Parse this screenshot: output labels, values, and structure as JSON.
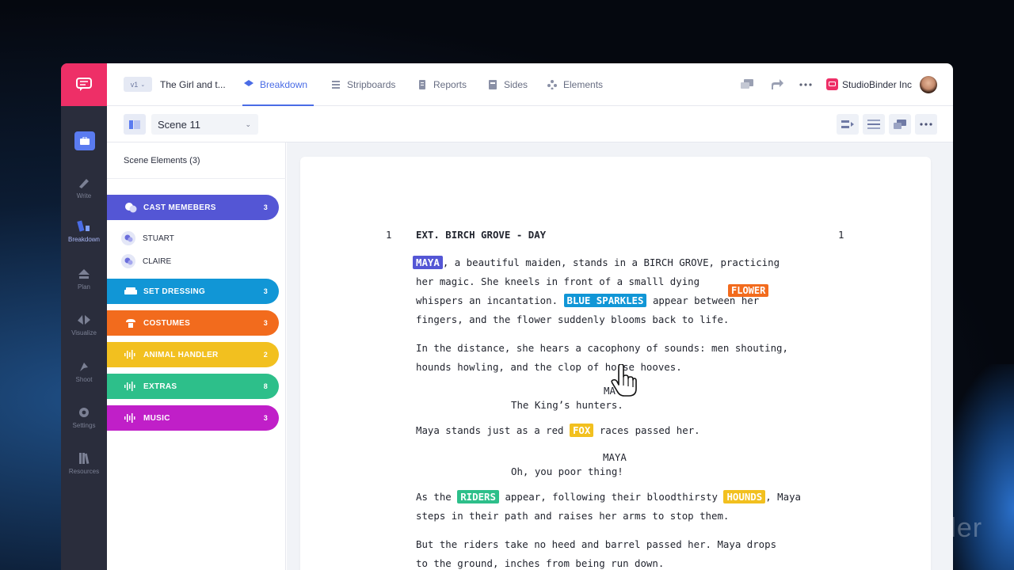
{
  "app": {
    "version": "v1",
    "project_title": "The Girl and t...",
    "company": "StudioBinder Inc",
    "background_brand": "nder"
  },
  "rail": {
    "items": [
      {
        "label": "Write",
        "icon": "pencil-icon"
      },
      {
        "label": "Breakdown",
        "icon": "breakdown-icon"
      },
      {
        "label": "Plan",
        "icon": "plan-icon"
      },
      {
        "label": "Visualize",
        "icon": "visualize-icon"
      },
      {
        "label": "Shoot",
        "icon": "shoot-icon"
      },
      {
        "label": "Settings",
        "icon": "gear-icon"
      },
      {
        "label": "Resources",
        "icon": "books-icon"
      }
    ]
  },
  "tabs": [
    {
      "label": "Breakdown",
      "icon": "layers-icon",
      "active": true
    },
    {
      "label": "Stripboards",
      "icon": "list-icon",
      "active": false
    },
    {
      "label": "Reports",
      "icon": "report-icon",
      "active": false
    },
    {
      "label": "Sides",
      "icon": "sides-icon",
      "active": false
    },
    {
      "label": "Elements",
      "icon": "elements-icon",
      "active": false
    }
  ],
  "subbar": {
    "scene": "Scene 11"
  },
  "panel": {
    "title": "Scene Elements (3)",
    "categories": [
      {
        "label": "CAST MEMEBERS",
        "count": "3",
        "color": "#5456d5",
        "icon": "masks-icon"
      },
      {
        "label": "SET DRESSING",
        "count": "3",
        "color": "#1196d6",
        "icon": "sofa-icon"
      },
      {
        "label": "COSTUMES",
        "count": "3",
        "color": "#f26b1d",
        "icon": "costume-icon"
      },
      {
        "label": "ANIMAL HANDLER",
        "count": "2",
        "color": "#f2c01f",
        "icon": "audio-icon"
      },
      {
        "label": "EXTRAS",
        "count": "8",
        "color": "#2dbf8a",
        "icon": "audio-icon"
      },
      {
        "label": "MUSIC",
        "count": "3",
        "color": "#c01fc8",
        "icon": "audio-icon"
      }
    ],
    "cast": [
      "STUART",
      "CLAIRE"
    ]
  },
  "script": {
    "scene_number": "1",
    "heading": "EXT. BIRCH GROVE - DAY",
    "p1": {
      "tag_maya": "MAYA",
      "l1_rest": ", a beautiful maiden, stands in a BIRCH GROVE, practicing",
      "l2": "her magic. She kneels in front of a smalll dying",
      "l3_a": "whispers an incantation. ",
      "tag_blue": "BLUE SPARKLES",
      "l3_b": " appear between her",
      "l4": "fingers, and the flower suddenly blooms back to life.",
      "tag_flower": "FLOWER"
    },
    "p2": {
      "l1": "In the distance, she hears a cacophony of sounds: men shouting,",
      "l2": "hounds howling, and the clop of horse hooves."
    },
    "d1": {
      "character": "MA",
      "line": "The King’s hunters."
    },
    "p3": {
      "a": "Maya stands just as a red ",
      "tag_fox": "FOX",
      "b": " races passed her."
    },
    "d2": {
      "character": "MAYA",
      "line": "Oh, you poor thing!"
    },
    "p4": {
      "a": "As the ",
      "tag_riders": "RIDERS",
      "b": " appear, following their bloodthirsty ",
      "tag_hounds": "HOUNDS",
      "c": ", Maya",
      "l2": "steps in their path and raises her arms to stop them."
    },
    "p5": {
      "l1": "But the riders take no heed and barrel passed her. Maya drops",
      "l2": "to the ground, inches from being run down."
    }
  }
}
